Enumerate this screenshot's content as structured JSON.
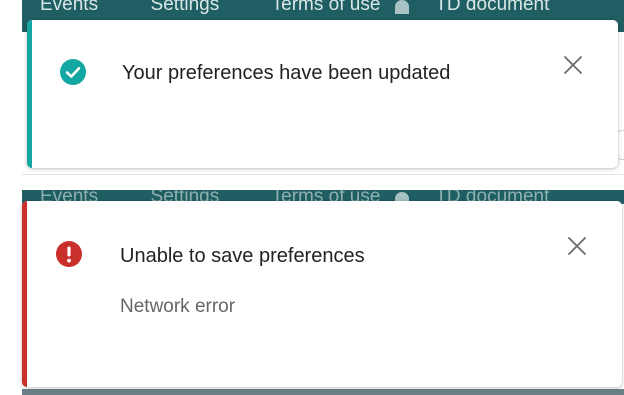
{
  "background": {
    "nav_items": [
      "Events",
      "Settings",
      "Terms of use",
      "TD document"
    ]
  },
  "toasts": {
    "success": {
      "title": "Your preferences have been updated",
      "icon": "check-circle-icon",
      "accent_color": "#14a6a0"
    },
    "error": {
      "title": "Unable to save preferences",
      "message": "Network error",
      "icon": "exclamation-circle-icon",
      "accent_color": "#c9302c"
    }
  },
  "close_icon": "close-icon"
}
